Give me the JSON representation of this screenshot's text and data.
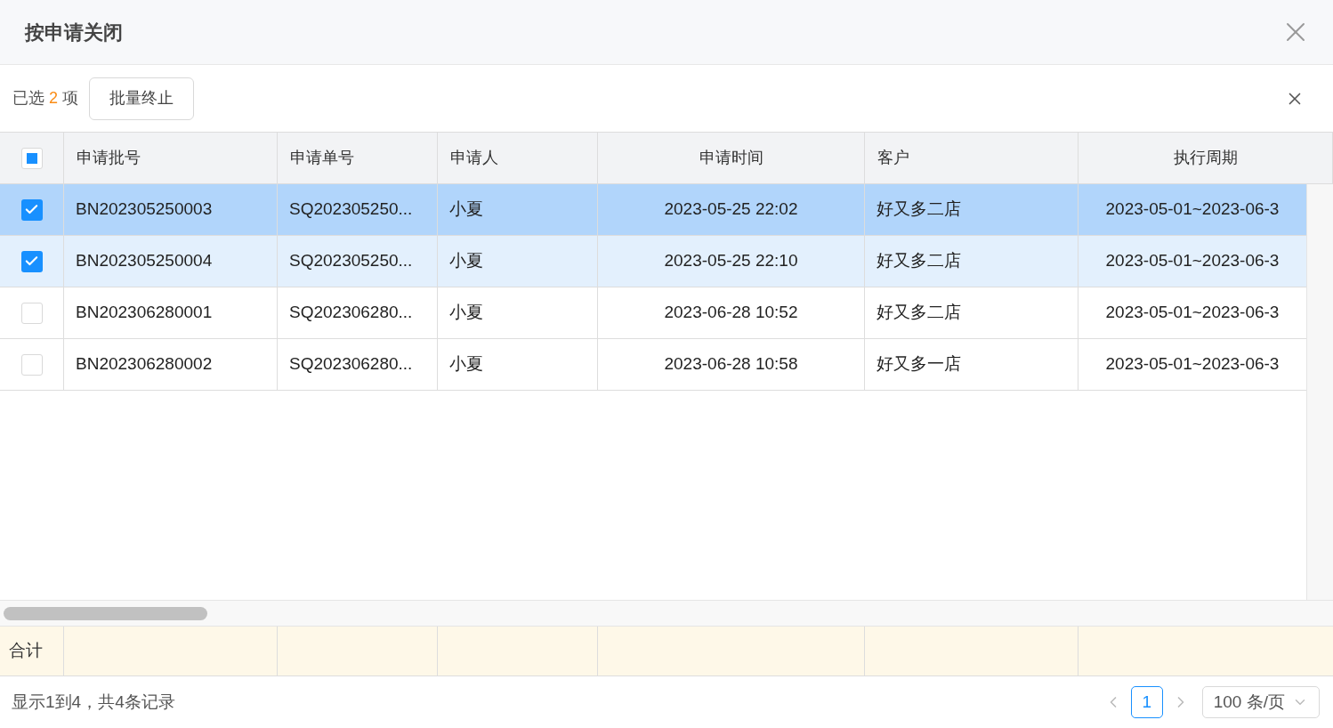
{
  "dialog": {
    "title": "按申请关闭"
  },
  "toolbar": {
    "selected_prefix": "已选",
    "selected_count": "2",
    "selected_suffix": "项",
    "batch_button": "批量终止"
  },
  "table": {
    "header_checkbox": {
      "indeterminate": true
    },
    "columns": [
      {
        "label": "申请批号"
      },
      {
        "label": "申请单号"
      },
      {
        "label": "申请人"
      },
      {
        "label": "申请时间"
      },
      {
        "label": "客户"
      },
      {
        "label": "执行周期"
      }
    ],
    "rows": [
      {
        "selected": true,
        "current": true,
        "cells": [
          "BN202305250003",
          "SQ202305250...",
          "小夏",
          "2023-05-25 22:02",
          "好又多二店",
          "2023-05-01~2023-06-3"
        ]
      },
      {
        "selected": true,
        "current": false,
        "cells": [
          "BN202305250004",
          "SQ202305250...",
          "小夏",
          "2023-05-25 22:10",
          "好又多二店",
          "2023-05-01~2023-06-3"
        ]
      },
      {
        "selected": false,
        "current": false,
        "cells": [
          "BN202306280001",
          "SQ202306280...",
          "小夏",
          "2023-06-28 10:52",
          "好又多二店",
          "2023-05-01~2023-06-3"
        ]
      },
      {
        "selected": false,
        "current": false,
        "cells": [
          "BN202306280002",
          "SQ202306280...",
          "小夏",
          "2023-06-28 10:58",
          "好又多一店",
          "2023-05-01~2023-06-3"
        ]
      }
    ],
    "summary_label": "合计"
  },
  "pagination": {
    "info": "显示1到4，共4条记录",
    "pages": [
      {
        "label": "1",
        "selected": true
      }
    ],
    "page_size": "100 条/页"
  }
}
